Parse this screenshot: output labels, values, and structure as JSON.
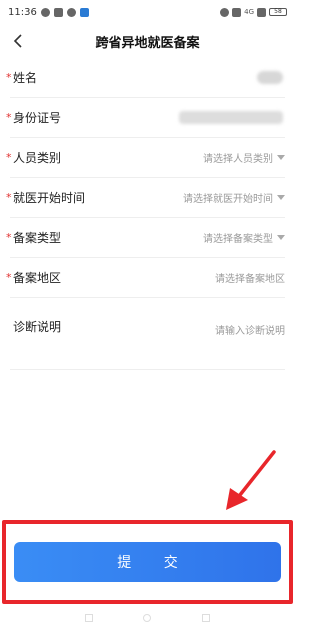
{
  "status_bar": {
    "time": "11:36",
    "network": "4G",
    "battery": "58"
  },
  "header": {
    "title": "跨省异地就医备案"
  },
  "form": {
    "required_mark": "*",
    "fields": [
      {
        "label": "姓名",
        "required": true,
        "value": ""
      },
      {
        "label": "身份证号",
        "required": true,
        "value": ""
      },
      {
        "label": "人员类别",
        "required": true,
        "placeholder": "请选择人员类别"
      },
      {
        "label": "就医开始时间",
        "required": true,
        "placeholder": "请选择就医开始时间"
      },
      {
        "label": "备案类型",
        "required": true,
        "placeholder": "请选择备案类型"
      },
      {
        "label": "备案地区",
        "required": true,
        "placeholder": "请选择备案地区"
      },
      {
        "label": "诊断说明",
        "required": false,
        "placeholder": "请输入诊断说明"
      }
    ]
  },
  "submit": {
    "label": "提 交"
  },
  "colors": {
    "accent": "#3a8df5",
    "highlight": "#e8262b",
    "required": "#e03131"
  }
}
